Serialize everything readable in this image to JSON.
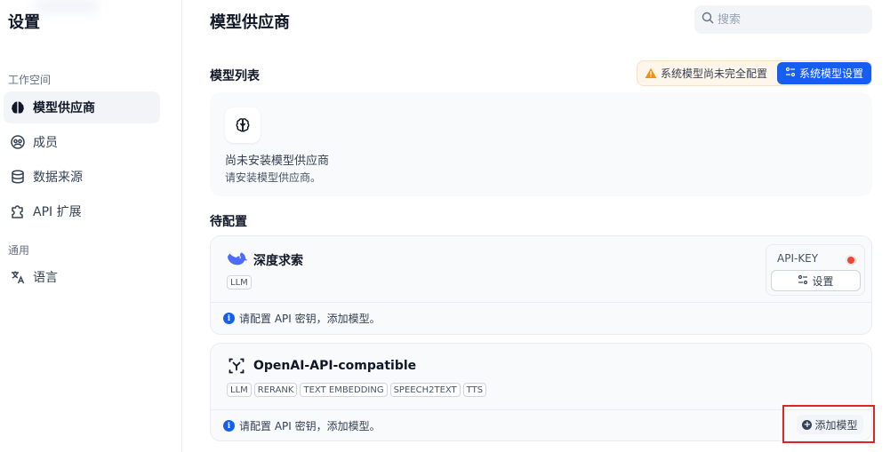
{
  "sidebar": {
    "title": "设置",
    "group_workspace": "工作空间",
    "group_general": "通用",
    "items": [
      {
        "label": "模型供应商",
        "icon": "brain-icon"
      },
      {
        "label": "成员",
        "icon": "members-icon"
      },
      {
        "label": "数据来源",
        "icon": "database-icon"
      },
      {
        "label": "API 扩展",
        "icon": "puzzle-icon"
      },
      {
        "label": "语言",
        "icon": "translate-icon"
      }
    ]
  },
  "header": {
    "title": "模型供应商",
    "search_placeholder": "搜索"
  },
  "model_list": {
    "title": "模型列表",
    "warning": "系统模型尚未完全配置",
    "system_settings_label": "系统模型设置",
    "empty_title": "尚未安装模型供应商",
    "empty_desc": "请安装模型供应商。"
  },
  "pending": {
    "title": "待配置",
    "providers": [
      {
        "name": "深度求索",
        "tags": [
          "LLM"
        ],
        "api_key_label": "API-KEY",
        "settings_label": "设置",
        "note": "请配置 API 密钥，添加模型。"
      },
      {
        "name": "OpenAI-API-compatible",
        "tags": [
          "LLM",
          "RERANK",
          "TEXT EMBEDDING",
          "SPEECH2TEXT",
          "TTS"
        ],
        "add_model_label": "添加模型",
        "note": "请配置 API 密钥，添加模型。"
      }
    ]
  },
  "colors": {
    "accent": "#155eef",
    "warning_bg": "#fef6ea",
    "status_red": "#f04438",
    "highlight_border": "#e02424"
  }
}
